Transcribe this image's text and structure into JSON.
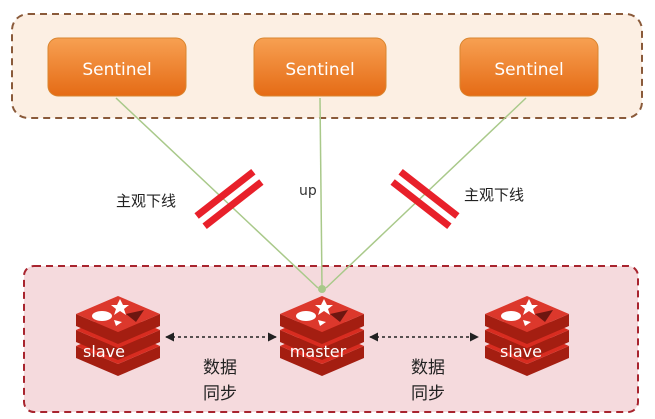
{
  "sentinels": [
    {
      "label": "Sentinel"
    },
    {
      "label": "Sentinel"
    },
    {
      "label": "Sentinel"
    }
  ],
  "edge_labels": {
    "left": "主观下线",
    "middle": "up",
    "right": "主观下线"
  },
  "nodes": {
    "left": {
      "label": "slave"
    },
    "center": {
      "label": "master"
    },
    "right": {
      "label": "slave"
    }
  },
  "sync_labels": {
    "left": {
      "line1": "数据",
      "line2": "同步"
    },
    "right": {
      "line1": "数据",
      "line2": "同步"
    }
  },
  "colors": {
    "sentinel_group_bg": "#fcefe3",
    "sentinel_group_border": "#8a5a3a",
    "sentinel_fill_top": "#f7a052",
    "sentinel_fill_bottom": "#e56b15",
    "node_group_bg": "#f5dadd",
    "node_group_border": "#a8242e",
    "connector": "#a9c98a",
    "fault_mark": "#e8202a",
    "redis_red": "#d82c20",
    "redis_dark": "#a41e11"
  },
  "icon_names": {
    "redis_logo": "redis-logo-icon",
    "fault_mark": "broken-link-icon"
  }
}
